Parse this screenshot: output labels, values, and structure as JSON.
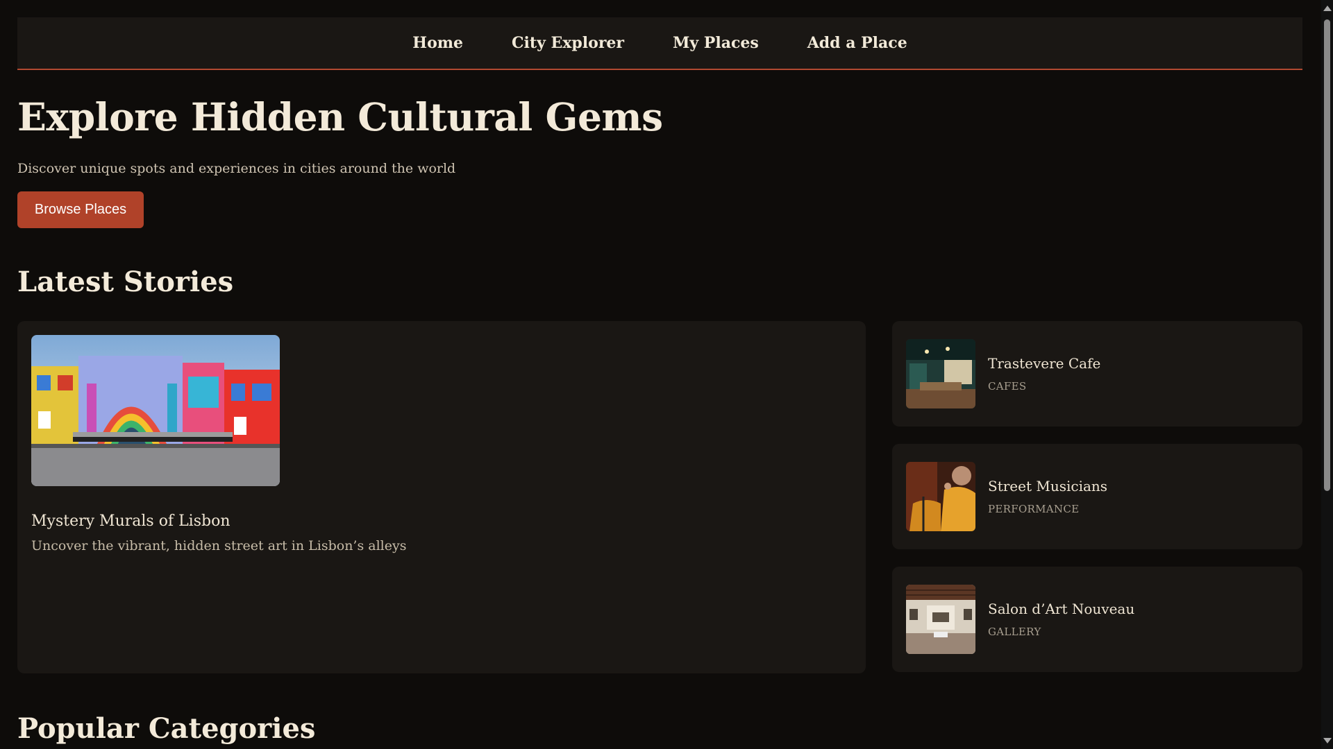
{
  "nav": {
    "items": [
      "Home",
      "City Explorer",
      "My Places",
      "Add a Place"
    ]
  },
  "hero": {
    "title": "Explore Hidden Cultural Gems",
    "subtitle": "Discover unique spots and experiences in cities around the world",
    "button_label": "Browse Places"
  },
  "latest": {
    "heading": "Latest Stories",
    "featured": {
      "title": "Mystery Murals of Lisbon",
      "description": "Uncover the vibrant, hidden street art in Lisbon’s alleys",
      "image_icon": "mural-image"
    },
    "side": [
      {
        "title": "Trastevere Cafe",
        "category": "CAFES",
        "image_icon": "cafe-image"
      },
      {
        "title": "Street Musicians",
        "category": "PERFORMANCE",
        "image_icon": "musicians-image"
      },
      {
        "title": "Salon d’Art Nouveau",
        "category": "GALLERY",
        "image_icon": "gallery-image"
      }
    ]
  },
  "popular": {
    "heading": "Popular Categories"
  },
  "colors": {
    "background": "#0e0c0a",
    "card": "#1a1714",
    "accent": "#b04229",
    "text": "#f3ead9"
  }
}
